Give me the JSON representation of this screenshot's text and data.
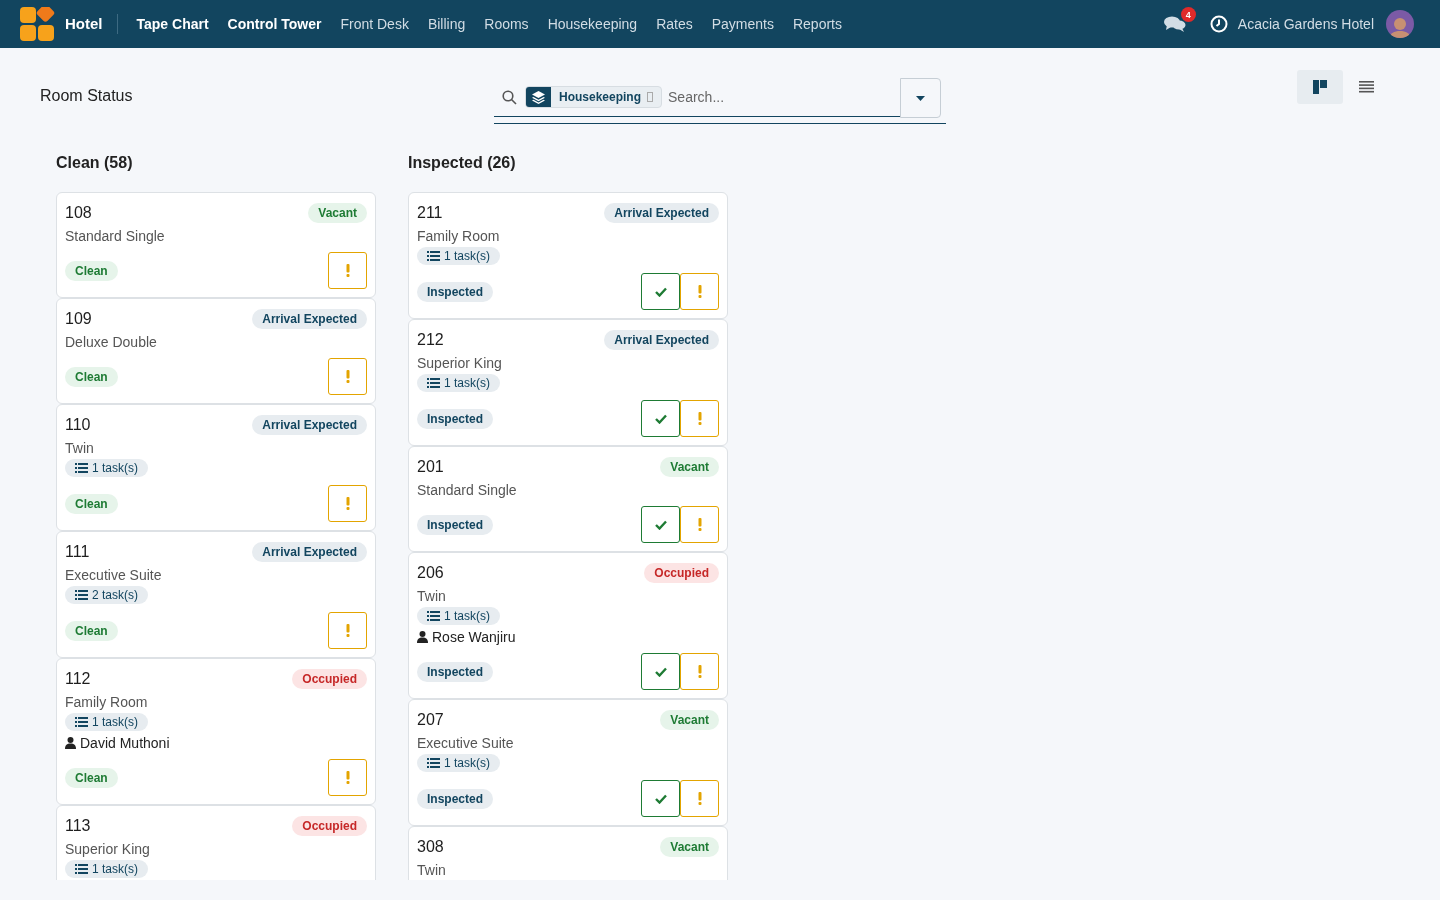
{
  "brand": "Hotel",
  "nav": [
    {
      "label": "Tape Chart",
      "bold": true
    },
    {
      "label": "Control Tower",
      "bold": true
    },
    {
      "label": "Front Desk",
      "bold": false
    },
    {
      "label": "Billing",
      "bold": false
    },
    {
      "label": "Rooms",
      "bold": false
    },
    {
      "label": "Housekeeping",
      "bold": false
    },
    {
      "label": "Rates",
      "bold": false
    },
    {
      "label": "Payments",
      "bold": false
    },
    {
      "label": "Reports",
      "bold": false
    }
  ],
  "messages_badge": "4",
  "property": "Acacia Gardens Hotel",
  "page_title": "Room Status",
  "search": {
    "chip": "Housekeeping",
    "placeholder": "Search..."
  },
  "views": [
    {
      "kind": "board",
      "selected": true
    },
    {
      "kind": "list",
      "selected": false
    }
  ],
  "columns": [
    {
      "title": "Clean (58)",
      "cards": [
        {
          "room": "108",
          "type": "Standard Single",
          "occupancy": {
            "kind": "vacant",
            "label": "Vacant"
          },
          "status": {
            "kind": "clean",
            "label": "Clean"
          },
          "can_inspect": false
        },
        {
          "room": "109",
          "type": "Deluxe Double",
          "occupancy": {
            "kind": "arrival",
            "label": "Arrival Expected"
          },
          "status": {
            "kind": "clean",
            "label": "Clean"
          },
          "can_inspect": false
        },
        {
          "room": "110",
          "type": "Twin",
          "tasks": "1 task(s)",
          "occupancy": {
            "kind": "arrival",
            "label": "Arrival Expected"
          },
          "status": {
            "kind": "clean",
            "label": "Clean"
          },
          "can_inspect": false
        },
        {
          "room": "111",
          "type": "Executive Suite",
          "tasks": "2 task(s)",
          "occupancy": {
            "kind": "arrival",
            "label": "Arrival Expected"
          },
          "status": {
            "kind": "clean",
            "label": "Clean"
          },
          "can_inspect": false
        },
        {
          "room": "112",
          "type": "Family Room",
          "tasks": "1 task(s)",
          "guest": "David Muthoni",
          "occupancy": {
            "kind": "occupied",
            "label": "Occupied"
          },
          "status": {
            "kind": "clean",
            "label": "Clean"
          },
          "can_inspect": false
        },
        {
          "room": "113",
          "type": "Superior King",
          "tasks": "1 task(s)",
          "occupancy": {
            "kind": "occupied",
            "label": "Occupied"
          }
        }
      ]
    },
    {
      "title": "Inspected (26)",
      "cards": [
        {
          "room": "211",
          "type": "Family Room",
          "tasks": "1 task(s)",
          "occupancy": {
            "kind": "arrival",
            "label": "Arrival Expected"
          },
          "status": {
            "kind": "inspected",
            "label": "Inspected"
          },
          "can_inspect": true
        },
        {
          "room": "212",
          "type": "Superior King",
          "tasks": "1 task(s)",
          "occupancy": {
            "kind": "arrival",
            "label": "Arrival Expected"
          },
          "status": {
            "kind": "inspected",
            "label": "Inspected"
          },
          "can_inspect": true
        },
        {
          "room": "201",
          "type": "Standard Single",
          "occupancy": {
            "kind": "vacant",
            "label": "Vacant"
          },
          "status": {
            "kind": "inspected",
            "label": "Inspected"
          },
          "can_inspect": true
        },
        {
          "room": "206",
          "type": "Twin",
          "tasks": "1 task(s)",
          "guest": "Rose Wanjiru",
          "occupancy": {
            "kind": "occupied",
            "label": "Occupied"
          },
          "status": {
            "kind": "inspected",
            "label": "Inspected"
          },
          "can_inspect": true
        },
        {
          "room": "207",
          "type": "Executive Suite",
          "tasks": "1 task(s)",
          "occupancy": {
            "kind": "vacant",
            "label": "Vacant"
          },
          "status": {
            "kind": "inspected",
            "label": "Inspected"
          },
          "can_inspect": true
        },
        {
          "room": "308",
          "type": "Twin",
          "occupancy": {
            "kind": "vacant",
            "label": "Vacant"
          }
        }
      ]
    }
  ]
}
